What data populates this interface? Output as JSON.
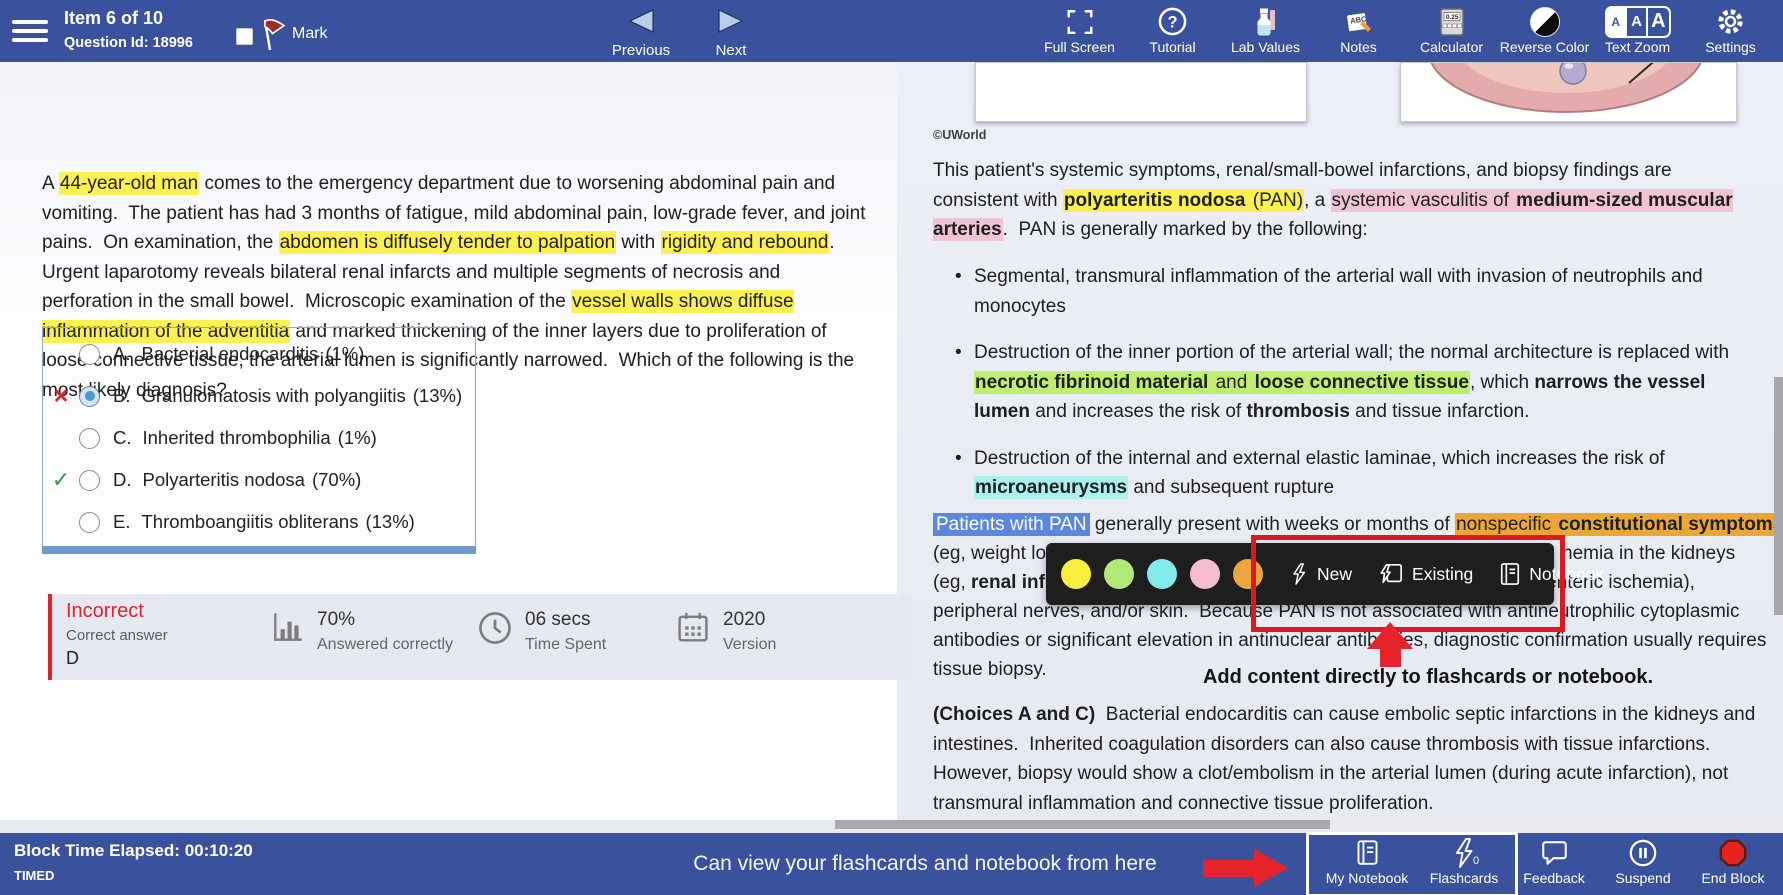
{
  "colors": {
    "bar_blue": "#3a529e",
    "incorrect_red": "#d9252c",
    "correct_green": "#2f9e44",
    "answer_bar_blue": "#6f9ac9",
    "hl_yellow": "#fcf151",
    "hl_pink": "#f2c4d6",
    "hl_green": "#c0ee6e",
    "hl_cyan": "#aaf1f0",
    "hl_blue": "#5b87dd",
    "hl_orange": "#eba733",
    "annotation_red": "#e5232b",
    "popup_bg": "#1e1e1e"
  },
  "top_bar": {
    "item_label": "Item 6 of 10",
    "question_id": "Question Id: 18996",
    "mark_label": "Mark",
    "mark_checked": false,
    "nav": [
      {
        "label": "Previous"
      },
      {
        "label": "Next"
      }
    ],
    "tools": [
      {
        "label": "Full Screen",
        "icon": "fullscreen-icon"
      },
      {
        "label": "Tutorial",
        "icon": "tutorial-icon"
      },
      {
        "label": "Lab Values",
        "icon": "lab-values-icon"
      },
      {
        "label": "Notes",
        "icon": "notes-icon"
      },
      {
        "label": "Calculator",
        "icon": "calculator-icon",
        "display": "0.25"
      },
      {
        "label": "Reverse Color",
        "icon": "reverse-color-icon"
      },
      {
        "label": "Text Zoom",
        "icon": "text-zoom-icon"
      },
      {
        "label": "Settings",
        "icon": "settings-icon"
      }
    ]
  },
  "question": {
    "segments": [
      {
        "t": "A "
      },
      {
        "t": "44-year-old man",
        "h": "yellow"
      },
      {
        "t": " comes to the emergency department due to worsening abdominal pain and vomiting.  The patient has had 3 months of fatigue, mild abdominal pain, low-grade fever, and joint pains.  On examination, the "
      },
      {
        "t": "abdomen is diffusely tender to palpation",
        "h": "yellow"
      },
      {
        "t": " with "
      },
      {
        "t": "rigidity and rebound",
        "h": "yellow"
      },
      {
        "t": ".  Urgent laparotomy reveals bilateral renal infarcts and multiple segments of necrosis and perforation in the small bowel.  Microscopic examination of the "
      },
      {
        "t": "vessel walls shows diffuse inflammation of the adventitia",
        "h": "yellow"
      },
      {
        "t": " and marked thickening of the inner layers due to proliferation of loose connective tissue; the arterial lumen is significantly narrowed.  Which of the following is the most likely diagnosis?"
      }
    ]
  },
  "answers": {
    "choices": [
      {
        "letter": "A.",
        "text": "Bacterial endocarditis",
        "pct": "(1%)",
        "selected": false,
        "result": null
      },
      {
        "letter": "B.",
        "text": "Granulomatosis with polyangiitis",
        "pct": "(13%)",
        "selected": true,
        "result": "incorrect"
      },
      {
        "letter": "C.",
        "text": "Inherited thrombophilia",
        "pct": "(1%)",
        "selected": false,
        "result": null
      },
      {
        "letter": "D.",
        "text": "Polyarteritis nodosa",
        "pct": "(70%)",
        "selected": false,
        "result": "correct"
      },
      {
        "letter": "E.",
        "text": "Thromboangiitis obliterans",
        "pct": "(13%)",
        "selected": false,
        "result": null
      }
    ]
  },
  "result": {
    "status": "Incorrect",
    "correct_answer_label": "Correct answer",
    "correct_answer": "D",
    "stats": [
      {
        "value": "70%",
        "label": "Answered correctly",
        "icon": "bar-chart-icon"
      },
      {
        "value": "06 secs",
        "label": "Time Spent",
        "icon": "clock-icon"
      },
      {
        "value": "2020",
        "label": "Version",
        "icon": "calendar-icon"
      }
    ]
  },
  "explanation": {
    "copyright": "©UWorld",
    "intro": [
      {
        "t": "This patient's systemic symptoms, renal/small-bowel infarctions, and biopsy findings are consistent with "
      },
      {
        "t": "polyarteritis nodosa",
        "h": "yellow",
        "b": true
      },
      {
        "t": " (PAN)",
        "h": "yellow"
      },
      {
        "t": ", a "
      },
      {
        "t": "systemic vasculitis of ",
        "h": "pink"
      },
      {
        "t": "medium-sized muscular arteries",
        "h": "pink",
        "b": true
      },
      {
        "t": ".  PAN is generally marked by the following:"
      }
    ],
    "bullets": [
      [
        {
          "t": "Segmental, transmural inflammation of the arterial wall with invasion of neutrophils and monocytes"
        }
      ],
      [
        {
          "t": "Destruction of the inner portion of the arterial wall; the normal architecture is replaced with "
        },
        {
          "t": "necrotic fibrinoid material",
          "h": "green",
          "b": true
        },
        {
          "t": " and ",
          "h": "green"
        },
        {
          "t": "loose connective tissue",
          "h": "green",
          "b": true
        },
        {
          "t": ", which "
        },
        {
          "t": "narrows the vessel lumen",
          "b": true
        },
        {
          "t": " and increases the risk of "
        },
        {
          "t": "thrombosis",
          "b": true
        },
        {
          "t": " and tissue infarction."
        }
      ],
      [
        {
          "t": "Destruction of the internal and external elastic laminae, which increases the risk of "
        },
        {
          "t": "microaneurysms",
          "h": "cyan",
          "b": true
        },
        {
          "t": " and subsequent rupture"
        }
      ]
    ],
    "pan_lines": {
      "l1": [
        {
          "t": "Patients with PAN",
          "h": "blue"
        },
        {
          "t": " generally present with weeks or months of "
        },
        {
          "t": "nonspecific ",
          "h": "orange"
        },
        {
          "t": "constitutional symptoms",
          "h": "orange",
          "b": true
        }
      ],
      "l2_left": [
        {
          "t": "(eg, weight lo"
        }
      ],
      "l2_right": [
        {
          "t": "hemia in the kidneys"
        }
      ],
      "l3_left": [
        {
          "t": "(eg, "
        },
        {
          "t": "renal inf",
          "b": true
        }
      ],
      "l3_right": [
        {
          "t": "esenteric ischemia),"
        }
      ],
      "l4": [
        {
          "t": "peripheral nerves, and/or skin.  Because PAN is not associated with antineutrophilic cytoplasmic"
        }
      ],
      "l5": [
        {
          "t": "antibodies or significant elevation in antinuclear antibodies, diagnostic confirmation usually requires"
        }
      ],
      "l6": [
        {
          "t": "tissue biopsy."
        }
      ]
    },
    "choices_para": [
      {
        "t": "(Choices A and C)",
        "b": true
      },
      {
        "t": "  Bacterial endocarditis can cause embolic septic infarctions in the kidneys and intestines.  Inherited coagulation disorders can also cause thrombosis with tissue infarctions.  However, biopsy would show a clot/embolism in the arterial lumen (during acute infarction), not transmural inflammation and connective tissue proliferation."
      }
    ]
  },
  "popup": {
    "highlight_colors": [
      "#f8ef3e",
      "#b2ea7a",
      "#82eaea",
      "#f6bcd2",
      "#eba63e"
    ],
    "actions": [
      {
        "label": "New",
        "icon": "bolt-icon"
      },
      {
        "label": "Existing",
        "icon": "bolt-card-icon"
      },
      {
        "label": "Notebook",
        "icon": "notebook-icon"
      }
    ]
  },
  "annotations": {
    "popup_note": "Add content directly to flashcards or notebook.",
    "footer_note": "Can view your flashcards and notebook from here"
  },
  "bottom_bar": {
    "time_elapsed": "Block Time Elapsed: 00:10:20",
    "mode": "TIMED",
    "buttons": [
      {
        "label": "My Notebook",
        "icon": "notebook-icon"
      },
      {
        "label": "Flashcards",
        "icon": "flashcard-bolt-icon",
        "badge": "0"
      },
      {
        "label": "Feedback",
        "icon": "feedback-bubble-icon"
      },
      {
        "label": "Suspend",
        "icon": "pause-icon"
      },
      {
        "label": "End Block",
        "icon": "stop-octagon-icon"
      }
    ]
  }
}
